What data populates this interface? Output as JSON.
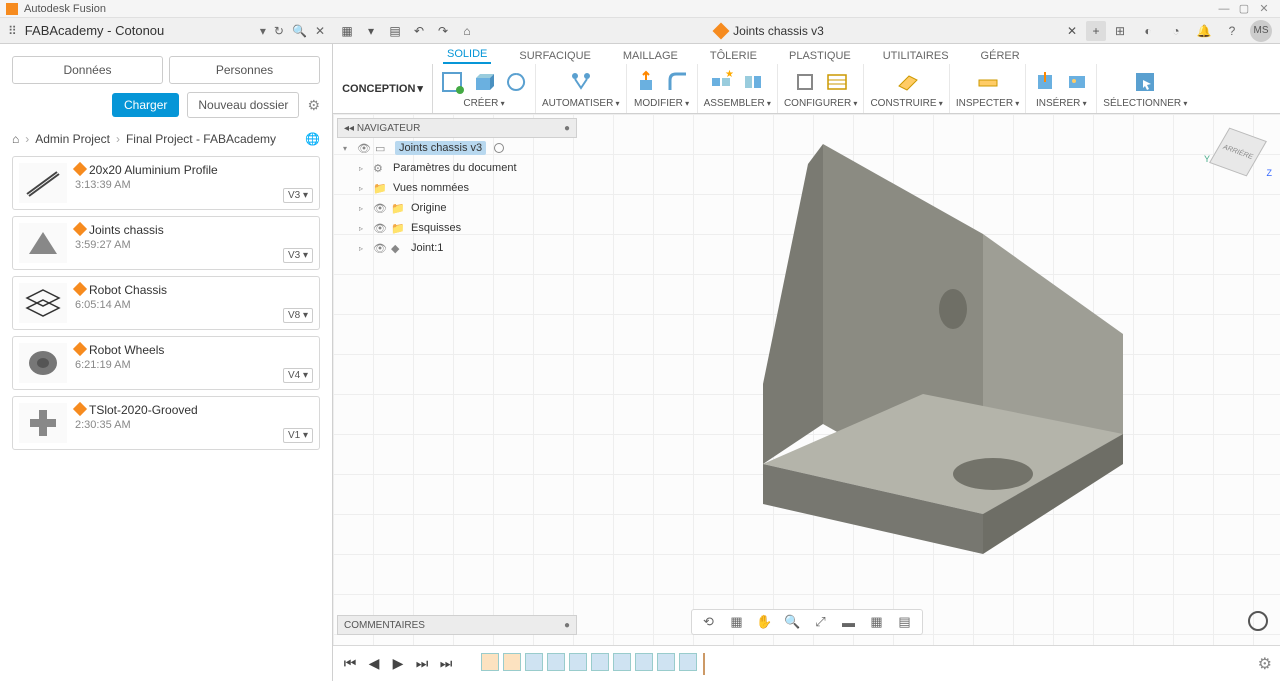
{
  "app": {
    "title": "Autodesk Fusion"
  },
  "window": {
    "min": "—",
    "max": "▢",
    "close": "✕"
  },
  "project": {
    "name": "FABAcademy - Cotonou",
    "refresh": "↻",
    "search": "🔍",
    "closepanel": "✕"
  },
  "qat": {
    "grid": "▦",
    "file": "▾",
    "save": "▤",
    "undo": "↶",
    "redo": "↷",
    "home": "⌂"
  },
  "doc": {
    "name": "Joints chassis v3",
    "close": "✕",
    "plus": "+"
  },
  "topright": {
    "ext": "⊞",
    "clock1": "◐",
    "clock2": "◔",
    "bell": "🔔",
    "help": "?",
    "avatar": "MS"
  },
  "leftpanel": {
    "tabs": {
      "data": "Données",
      "people": "Personnes"
    },
    "actions": {
      "upload": "Charger",
      "newfolder": "Nouveau dossier"
    },
    "breadcrumb": {
      "l1": "Admin Project",
      "l2": "Final Project - FABAcademy"
    },
    "files": [
      {
        "name": "20x20 Aluminium Profile",
        "time": "3:13:39 AM",
        "ver": "V3 ▾"
      },
      {
        "name": "Joints chassis",
        "time": "3:59:27 AM",
        "ver": "V3 ▾"
      },
      {
        "name": "Robot Chassis",
        "time": "6:05:14 AM",
        "ver": "V8 ▾"
      },
      {
        "name": "Robot Wheels",
        "time": "6:21:19 AM",
        "ver": "V4 ▾"
      },
      {
        "name": "TSlot-2020-Grooved",
        "time": "2:30:35 AM",
        "ver": "V1 ▾"
      }
    ]
  },
  "ribbontabs": {
    "solid": "SOLIDE",
    "surface": "SURFACIQUE",
    "mesh": "MAILLAGE",
    "sheet": "TÔLERIE",
    "plastic": "PLASTIQUE",
    "util": "UTILITAIRES",
    "manage": "GÉRER"
  },
  "ribbon": {
    "conception": "CONCEPTION",
    "groups": {
      "create": "CRÉER",
      "auto": "AUTOMATISER",
      "modify": "MODIFIER",
      "assemble": "ASSEMBLER",
      "config": "CONFIGURER",
      "construct": "CONSTRUIRE",
      "inspect": "INSPECTER",
      "insert": "INSÉRER",
      "select": "SÉLECTIONNER"
    }
  },
  "browser": {
    "title": "NAVIGATEUR",
    "root": "Joints chassis v3",
    "items": {
      "params": "Paramètres du document",
      "views": "Vues nommées",
      "origin": "Origine",
      "sketches": "Esquisses",
      "body": "Joint:1"
    }
  },
  "viewcube": {
    "face": "ARRIÈRE",
    "y": "Y",
    "z": "Z"
  },
  "comments": {
    "title": "COMMENTAIRES"
  },
  "viewtools": {
    "orbit": "⟲",
    "look": "▦",
    "pan": "✋",
    "zoom": "🔍",
    "fit": "⤢",
    "disp": "▬",
    "grd": "▦",
    "vs": "▤"
  },
  "timeline": {
    "first": "⏮",
    "prev": "◀",
    "play": "▶",
    "next": "⏭",
    "last": "⏭"
  }
}
